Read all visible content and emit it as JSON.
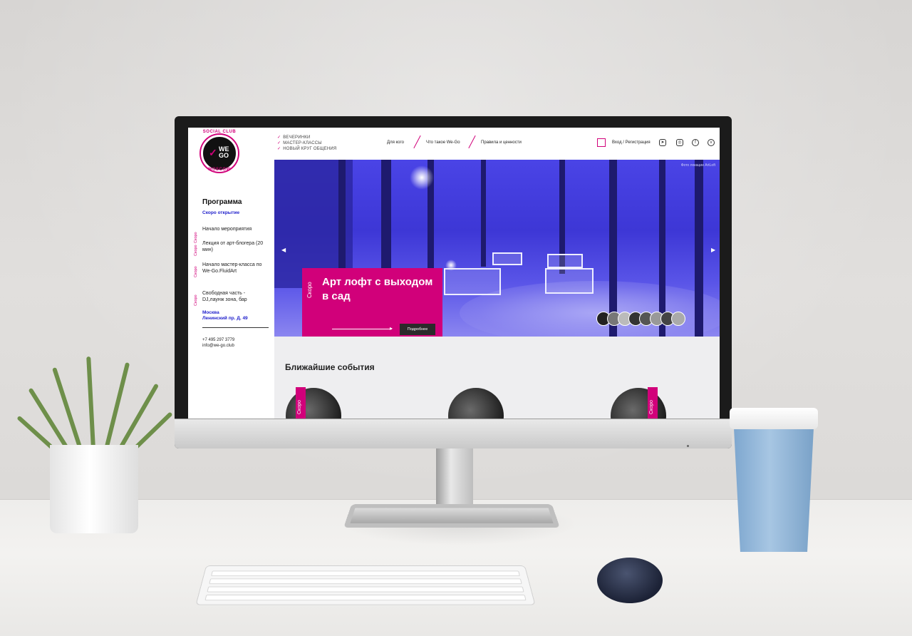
{
  "sidebar": {
    "logo": {
      "ring_top": "SOCIAL CLUB",
      "ring_bottom": "MOSCOW",
      "mark": "WE GO"
    },
    "program_title": "Программа",
    "soon_opening": "Скоро открытие",
    "events": [
      {
        "label": "Начало мероприятия",
        "tag": ""
      },
      {
        "label": "Лекция от арт-блогера (20 мин)",
        "tag": "Скоро"
      },
      {
        "label": "Начало мастер-класса по We-Go.FluidArt",
        "tag": "Скоро"
      },
      {
        "label": "Свободная часть - DJ,лаунж зона, бар",
        "tag": "Скоро"
      }
    ],
    "extra_tag": "Скоро",
    "address": {
      "city": "Москва",
      "street": "Ленинский пр. Д. 49"
    },
    "phone": "+7 495 297 3779",
    "email": "info@we-go.club"
  },
  "topbar": {
    "features": [
      "ВЕЧЕРИНКИ",
      "МАСТЕР-КЛАССЫ",
      "НОВЫЙ КРУГ ОБЩЕНИЯ"
    ],
    "nav": [
      "Для кого",
      "Что такое We-Go",
      "Правила и ценности"
    ],
    "login": "Вход / Регистрация",
    "social_icons": [
      "telegram-icon",
      "instagram-icon",
      "facebook-icon",
      "vk-icon"
    ]
  },
  "hero": {
    "photo_credit": "Фото локации ArtLoft",
    "card_tag": "Скоро",
    "card_title": "Арт лофт с выходом в сад",
    "more_button": "Подробнее",
    "prev_icon": "arrow-left-icon",
    "next_icon": "arrow-right-icon"
  },
  "events_section": {
    "title": "Ближайшие события",
    "cards": [
      {
        "tag": "Скоро"
      },
      {
        "tag": ""
      },
      {
        "tag": "Скоро"
      }
    ]
  },
  "colors": {
    "accent": "#d1007a",
    "hero_blue": "#4a44e6",
    "link_blue": "#2222cc"
  }
}
